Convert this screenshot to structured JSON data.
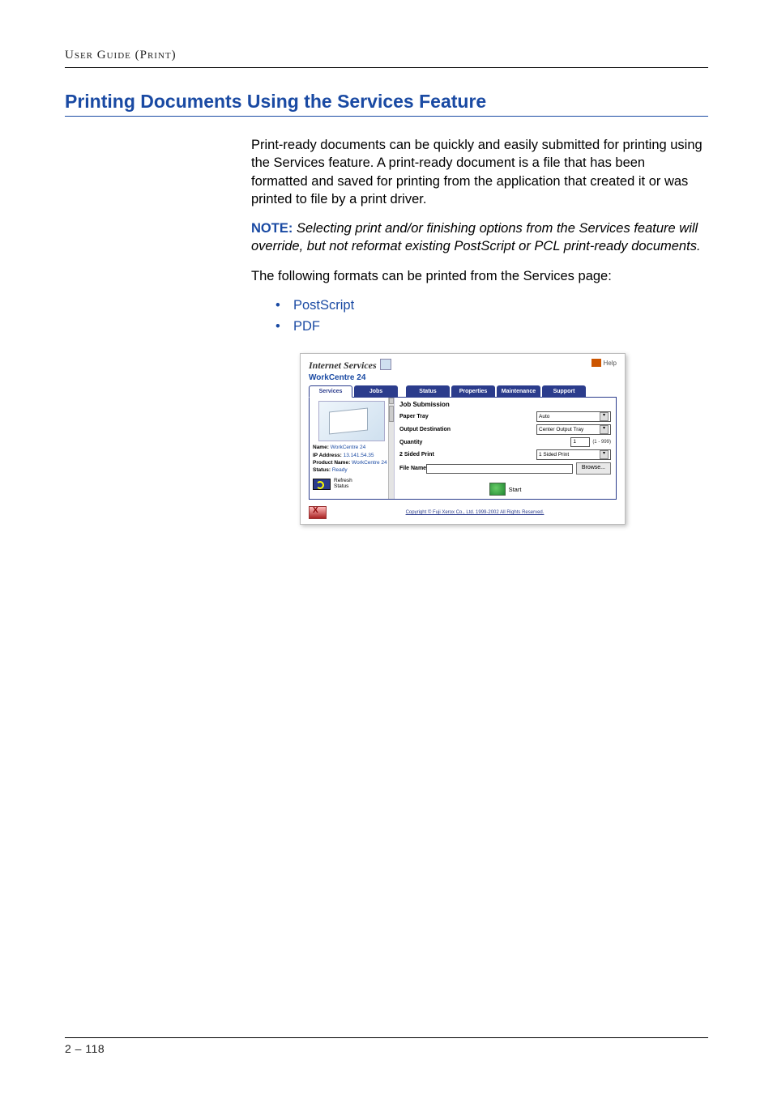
{
  "running_head": "User Guide (Print)",
  "section_title": "Printing Documents Using the Services Feature",
  "para1": "Print-ready documents can be quickly and easily submitted for printing using the Services feature. A print-ready document is a file that has been formatted and saved for printing from the application that created it or was printed to file by a print driver.",
  "note_label": "NOTE:",
  "note_text": "Selecting print and/or finishing options from the Services feature will override, but not reformat existing PostScript or PCL print-ready documents.",
  "para2": "The following formats can be printed from the Services page:",
  "formats": [
    "PostScript",
    "PDF"
  ],
  "page_number": "2 – 118",
  "shot": {
    "title": "Internet Services",
    "subtitle": "WorkCentre 24",
    "help": "Help",
    "tabs": [
      "Services",
      "Jobs",
      "Status",
      "Properties",
      "Maintenance",
      "Support"
    ],
    "active_tab": 0,
    "side": {
      "name_label": "Name:",
      "name": "WorkCentre 24",
      "ip_label": "IP Address:",
      "ip": "13.141.54.35",
      "prod_label": "Product Name:",
      "prod": "WorkCentre 24",
      "status_label": "Status:",
      "status": "Ready",
      "refresh_l1": "Refresh",
      "refresh_l2": "Status"
    },
    "form": {
      "heading": "Job Submission",
      "paper_tray_label": "Paper Tray",
      "paper_tray_value": "Auto",
      "output_label": "Output Destination",
      "output_value": "Center Output Tray",
      "quantity_label": "Quantity",
      "quantity_value": "1",
      "quantity_range": "(1 - 999)",
      "twosided_label": "2 Sided Print",
      "twosided_value": "1 Sided Print",
      "filename_label": "File Name",
      "browse": "Browse...",
      "start": "Start"
    },
    "copyright": "Copyright © Fuji Xerox Co., Ltd. 1999-2002 All Rights Reserved."
  }
}
